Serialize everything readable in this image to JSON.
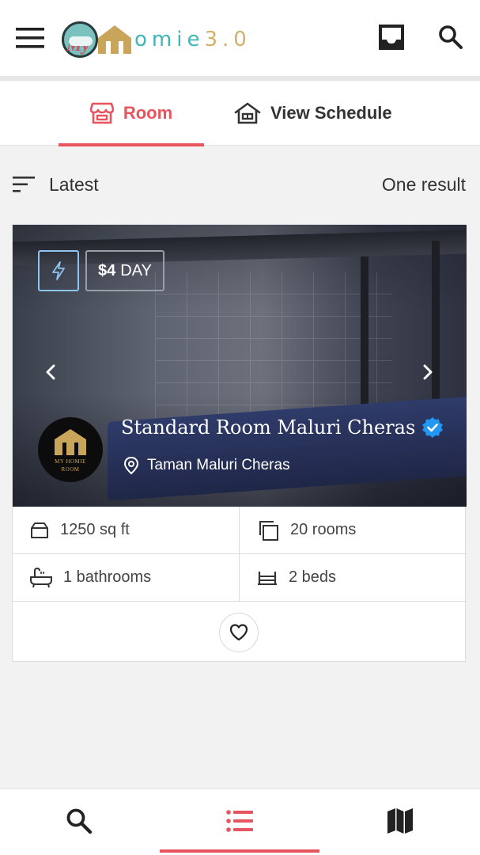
{
  "header": {
    "logo": {
      "my": "My",
      "brand_text_teal": "omie",
      "brand_text_gold": "3.0"
    },
    "icons": {
      "menu": "menu-icon",
      "inbox": "inbox-icon",
      "search": "search-icon"
    }
  },
  "tabs": [
    {
      "label": "Room",
      "icon": "store-icon",
      "active": true
    },
    {
      "label": "View Schedule",
      "icon": "house-icon",
      "active": false
    }
  ],
  "sort": {
    "label": "Latest",
    "icon": "sort-icon",
    "result_count": "One result"
  },
  "listing": {
    "badges": {
      "instant_icon": "lightning-icon",
      "price": "$4",
      "price_unit": "DAY"
    },
    "title": "Standard Room Maluri Cheras",
    "verified": true,
    "location": "Taman Maluri Cheras",
    "owner_avatar": {
      "text_line1": "MY HOMIE",
      "text_line2": "ROOM"
    },
    "stats": {
      "area": "1250 sq ft",
      "rooms": "20 rooms",
      "bathrooms": "1 bathrooms",
      "beds": "2 beds"
    }
  },
  "bottom_nav": [
    {
      "icon": "search-icon",
      "active": false
    },
    {
      "icon": "list-icon",
      "active": true
    },
    {
      "icon": "map-icon",
      "active": false
    }
  ],
  "colors": {
    "accent": "#e8545e",
    "teal": "#3eb7b5",
    "gold": "#d2b06a",
    "verified": "#2196f3"
  }
}
